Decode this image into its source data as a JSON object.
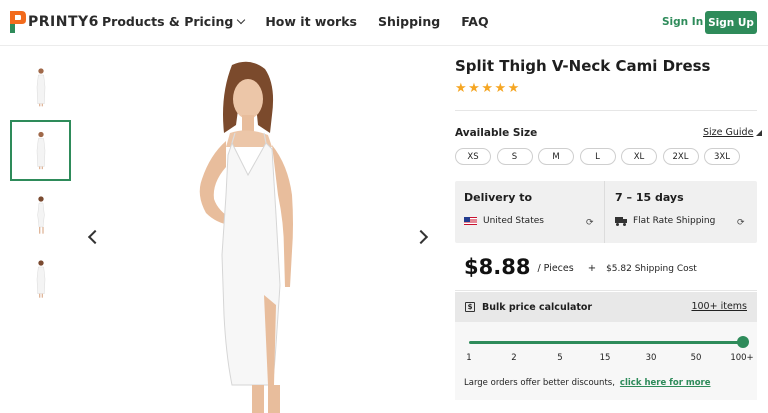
{
  "brand": {
    "name": "PRINTY6",
    "colors": {
      "accent": "#2e8b5a",
      "logo_orange": "#f26b1d",
      "logo_green": "#2e8b5a",
      "star": "#f5a623"
    }
  },
  "nav": {
    "items": [
      {
        "label": "Products & Pricing",
        "has_dropdown": true
      },
      {
        "label": "How it works"
      },
      {
        "label": "Shipping"
      },
      {
        "label": "FAQ"
      }
    ],
    "sign_in": "Sign In",
    "sign_up": "Sign Up"
  },
  "gallery": {
    "thumbnails": [
      "front-view",
      "front-view-selected",
      "side-view",
      "back-view"
    ],
    "active_index": 1,
    "prev_icon": "chevron-left-icon",
    "next_icon": "chevron-right-icon"
  },
  "product": {
    "title": "Split Thigh V-Neck Cami Dress",
    "rating": 5,
    "size_label": "Available Size",
    "size_guide": "Size Guide",
    "sizes": [
      "XS",
      "S",
      "M",
      "L",
      "XL",
      "2XL",
      "3XL"
    ]
  },
  "delivery": {
    "to_label": "Delivery to",
    "country": "United States",
    "time": "7 – 15 days",
    "method": "Flat Rate Shipping"
  },
  "pricing": {
    "price": "$8.88",
    "unit": "/ Pieces",
    "plus": "+",
    "shipping": "$5.82 Shipping Cost"
  },
  "bulk": {
    "label": "Bulk price calculator",
    "link": "100+ items",
    "icon": "dollar-icon",
    "ticks": [
      "1",
      "2",
      "5",
      "15",
      "30",
      "50",
      "100+"
    ],
    "selected": "100+",
    "note": "Large orders offer better discounts,",
    "note_link": "click here for more"
  }
}
